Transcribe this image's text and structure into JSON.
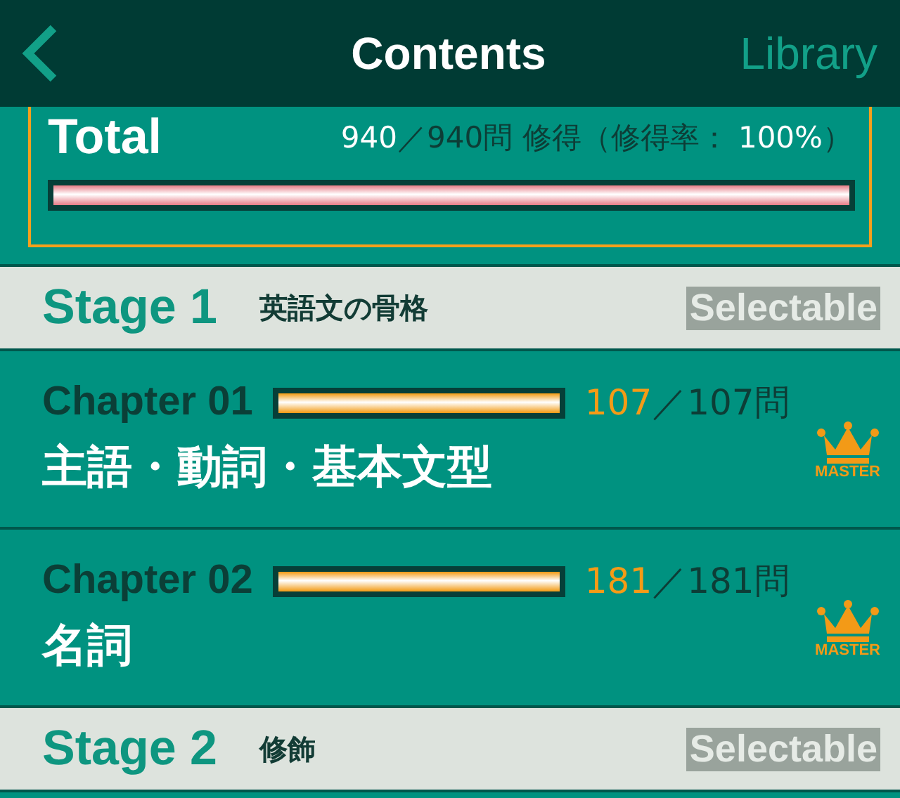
{
  "nav": {
    "title": "Contents",
    "right_link": "Library"
  },
  "total": {
    "label": "Total",
    "done": "940",
    "rest": "／940問 修得（修得率：",
    "rate": "100%",
    "end": "）",
    "level": 1
  },
  "sections": [
    {
      "kind": "stage",
      "title": "Stage 1",
      "subtitle": "英語文の骨格",
      "badge": "Selectable"
    },
    {
      "kind": "chapter",
      "title": "Chapter 01",
      "level": 1,
      "done": "107",
      "rest": "／107問",
      "name": "主語・動詞・基本文型",
      "mastered": true,
      "master_label": "MASTER"
    },
    {
      "kind": "chapter",
      "title": "Chapter 02",
      "level": 1,
      "done": "181",
      "rest": "／181問",
      "name": "名詞",
      "mastered": true,
      "master_label": "MASTER"
    },
    {
      "kind": "stage",
      "title": "Stage 2",
      "subtitle": "修飾",
      "badge": "Selectable"
    }
  ]
}
